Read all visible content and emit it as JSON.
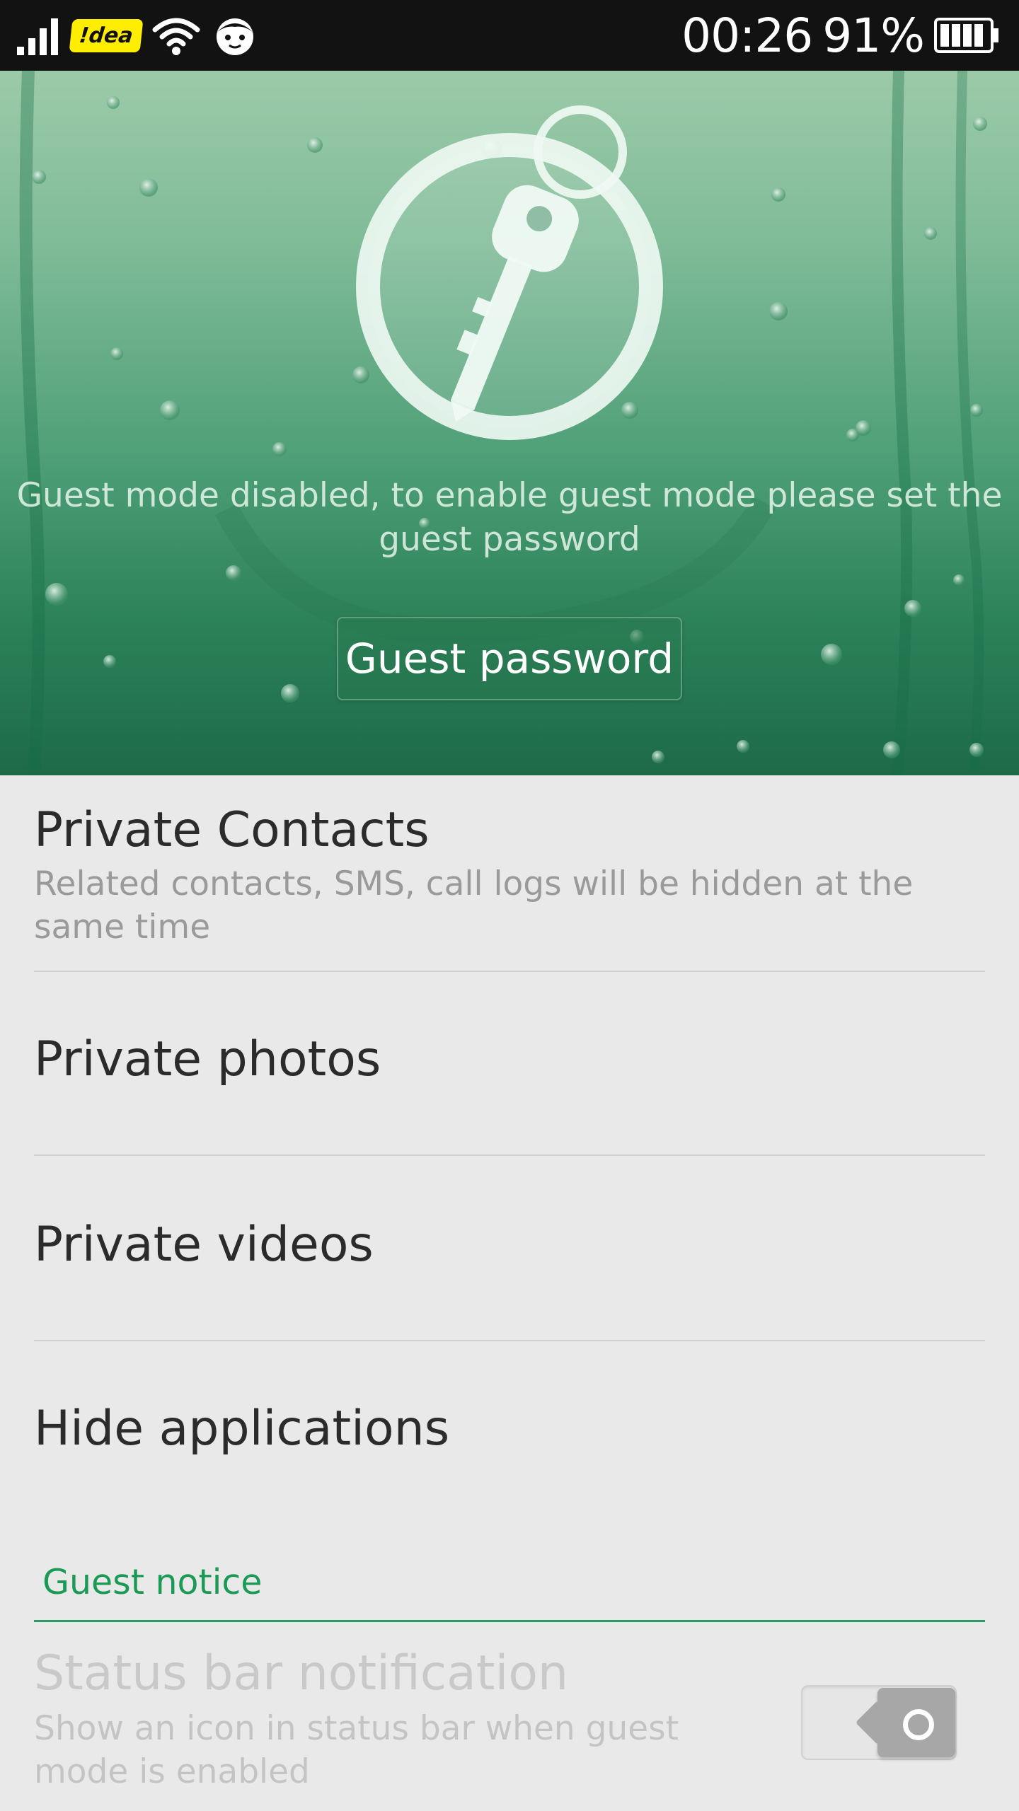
{
  "status_bar": {
    "carrier": "!dea",
    "time": "00:26",
    "battery_percent": "91%",
    "icons": [
      "signal-icon",
      "carrier-badge",
      "wifi-icon",
      "guest-face-icon",
      "battery-icon"
    ]
  },
  "hero": {
    "message": "Guest mode disabled, to enable guest mode please set the guest password",
    "button_label": "Guest password",
    "icon": "key-icon",
    "colors": {
      "top": "#9ccaa9",
      "bottom": "#1d6a47"
    }
  },
  "list": {
    "items": [
      {
        "title": "Private Contacts",
        "subtitle": "Related contacts, SMS, call logs will be hidden at the same time"
      },
      {
        "title": "Private photos"
      },
      {
        "title": "Private videos"
      },
      {
        "title": "Hide applications"
      }
    ],
    "section": {
      "header": "Guest notice",
      "accent_color": "#1a9a55",
      "setting": {
        "title": "Status bar notification",
        "subtitle": "Show an icon in status bar when guest mode is enabled",
        "enabled": false,
        "toggle_on": true
      }
    }
  }
}
